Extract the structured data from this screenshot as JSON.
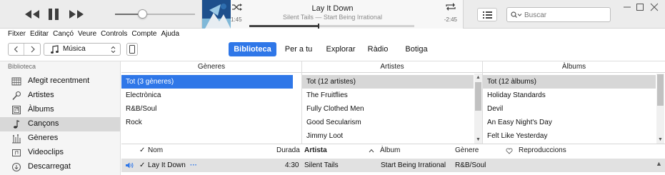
{
  "player": {
    "track_title": "Lay It Down",
    "track_subtitle": "Silent Tails — Start Being Irrational",
    "elapsed": "1:45",
    "remaining": "-2:45",
    "volume_level": 0.34,
    "progress_level": 0.42,
    "search_placeholder": "Buscar",
    "accent_color": "#2f77e8"
  },
  "menu": [
    "Fitxer",
    "Editar",
    "Cançó",
    "Veure",
    "Controls",
    "Compte",
    "Ajuda"
  ],
  "nav": {
    "media_type": "Música",
    "tabs": [
      "Biblioteca",
      "Per a tu",
      "Explorar",
      "Ràdio",
      "Botiga"
    ],
    "active_tab": "Biblioteca"
  },
  "sidebar": {
    "header": "Biblioteca",
    "items": [
      {
        "label": "Afegit recentment",
        "icon": "recently-added-icon"
      },
      {
        "label": "Artistes",
        "icon": "microphone-icon"
      },
      {
        "label": "Àlbums",
        "icon": "album-icon"
      },
      {
        "label": "Cançons",
        "icon": "music-note-icon",
        "selected": true
      },
      {
        "label": "Gèneres",
        "icon": "genres-icon"
      },
      {
        "label": "Videoclips",
        "icon": "video-icon"
      },
      {
        "label": "Descarregat",
        "icon": "download-icon"
      }
    ]
  },
  "browser": {
    "genres": {
      "header": "Gèneres",
      "rows": [
        "Tot (3 gèneres)",
        "Electrònica",
        "R&B/Soul",
        "Rock"
      ]
    },
    "artists": {
      "header": "Artistes",
      "rows": [
        "Tot (12 artistes)",
        "The Fruitflies",
        "Fully Clothed Men",
        "Good Secularism",
        "Jimmy Loot"
      ]
    },
    "albums": {
      "header": "Àlbums",
      "rows": [
        "Tot (12 àlbums)",
        "Holiday Standards",
        "Devil",
        "An Easy Night's Day",
        "Felt Like Yesterday"
      ]
    }
  },
  "songs": {
    "headers": {
      "check": "✓",
      "name": "Nom",
      "duration": "Durada",
      "artist": "Artista",
      "album": "Àlbum",
      "genre": "Gènere",
      "plays": "Reproduccions"
    },
    "rows": [
      {
        "check": "✓",
        "name": "Lay It Down",
        "more": "···",
        "duration": "4:30",
        "artist": "Silent Tails",
        "album": "Start Being Irrational",
        "genre": "R&B/Soul"
      }
    ]
  }
}
